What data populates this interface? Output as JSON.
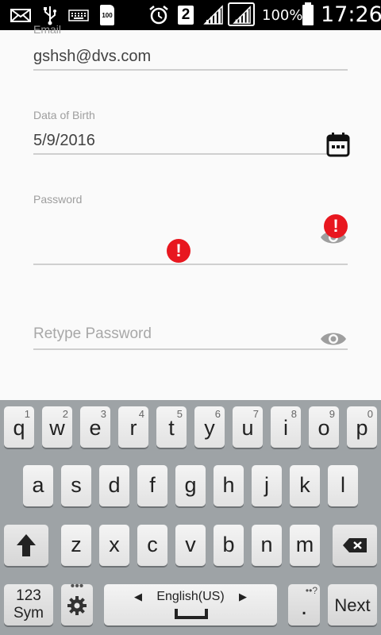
{
  "status_bar": {
    "battery_percent": "100%",
    "time": "17:26",
    "notif_badge": "2",
    "sd_label": "100",
    "icons": [
      "mail-icon",
      "usb-icon",
      "keyboard-icon",
      "sd-card-icon",
      "alarm-icon",
      "sim2-icon",
      "signal-icon",
      "signal-icon",
      "battery-icon"
    ]
  },
  "form": {
    "email": {
      "label": "Email",
      "value": "gshsh@dvs.com"
    },
    "dob": {
      "label": "Data of Birth",
      "value": "5/9/2016"
    },
    "password": {
      "label": "Password",
      "value": ""
    },
    "retype_password": {
      "placeholder": "Retype Password"
    }
  },
  "keyboard": {
    "row1": [
      {
        "k": "q",
        "s": "1"
      },
      {
        "k": "w",
        "s": "2"
      },
      {
        "k": "e",
        "s": "3"
      },
      {
        "k": "r",
        "s": "4"
      },
      {
        "k": "t",
        "s": "5"
      },
      {
        "k": "y",
        "s": "6"
      },
      {
        "k": "u",
        "s": "7"
      },
      {
        "k": "i",
        "s": "8"
      },
      {
        "k": "o",
        "s": "9"
      },
      {
        "k": "p",
        "s": "0"
      }
    ],
    "row2": [
      "a",
      "s",
      "d",
      "f",
      "g",
      "h",
      "j",
      "k",
      "l"
    ],
    "row3": [
      "z",
      "x",
      "c",
      "v",
      "b",
      "n",
      "m"
    ],
    "sym_label_1": "123",
    "sym_label_2": "Sym",
    "language": "English(US)",
    "period": ".",
    "period_sub": "••?",
    "next": "Next"
  },
  "colors": {
    "error": "#e8171f",
    "statusbar": "#000000",
    "keyboard_bg": "#9ea3a6"
  }
}
